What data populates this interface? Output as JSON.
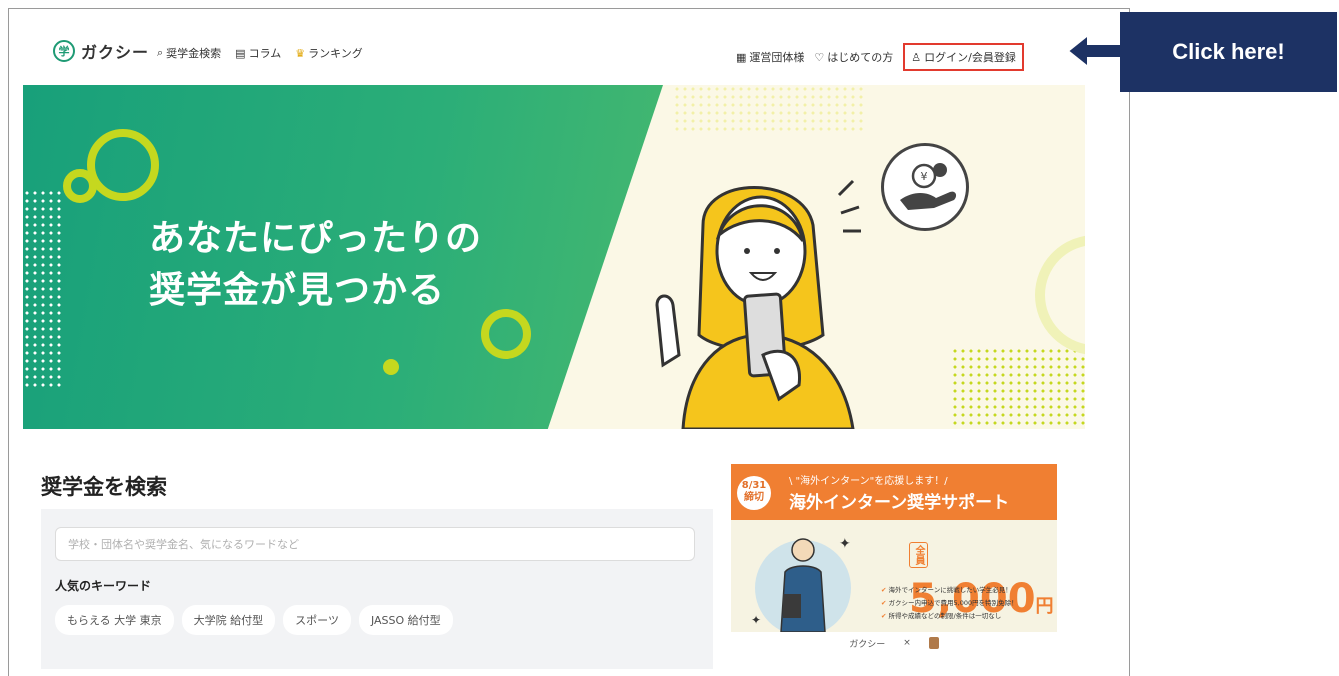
{
  "header": {
    "logo_mark": "学",
    "logo_text": "ガクシー",
    "nav_left": [
      {
        "icon": "search-icon",
        "glyph": "⌕",
        "label": "奨学金検索"
      },
      {
        "icon": "book-icon",
        "glyph": "▤",
        "label": "コラム"
      },
      {
        "icon": "crown-icon",
        "glyph": "♛",
        "label": "ランキング"
      }
    ],
    "nav_right": [
      {
        "icon": "building-icon",
        "glyph": "▦",
        "label": "運営団体様"
      },
      {
        "icon": "pin-icon",
        "glyph": "♡",
        "label": "はじめての方"
      }
    ],
    "login": {
      "icon": "user-icon",
      "glyph": "♙",
      "label": "ログイン/会員登録",
      "highlight": "#e23a2e"
    }
  },
  "hero": {
    "title_line1": "あなたにぴったりの",
    "title_line2": "奨学金が見つかる",
    "yen_symbol": "¥",
    "colors": {
      "green": "#18a07a",
      "lime": "#c5d81f",
      "cream": "#fbf8e6"
    }
  },
  "search": {
    "title": "奨学金を検索",
    "placeholder": "学校・団体名や奨学金名、気になるワードなど",
    "keywords_label": "人気のキーワード",
    "keywords": [
      "もらえる 大学 東京",
      "大学院 給付型",
      "スポーツ",
      "JASSO 給付型"
    ]
  },
  "promo": {
    "deadline_date": "8/31",
    "deadline_label": "締切",
    "subtitle": "\\ \"海外インターン\"を応援します！/",
    "title": "海外インターン奨学サポート",
    "amount_prefix": "全員",
    "amount": "5,000",
    "amount_unit": "円",
    "points": [
      "海外でインターンに挑戦したい学生必見！",
      "ガクシー内申込で費用5,000円を特別免除！",
      "所得や成績などの制限/条件は一切なし"
    ],
    "footer_logo": "ガクシー",
    "footer_x": "×"
  },
  "callout": {
    "text": "Click here!",
    "color": "#1d3264"
  }
}
